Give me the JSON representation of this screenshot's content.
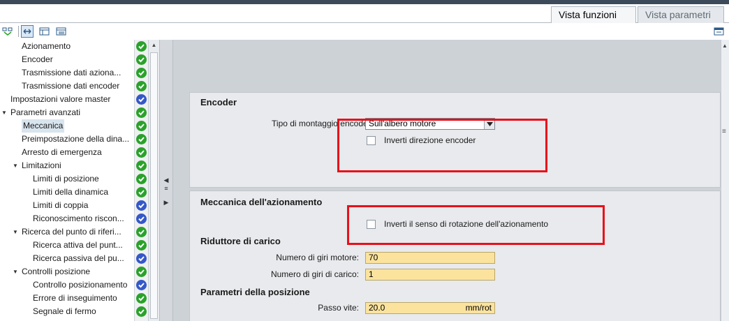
{
  "tabs": [
    {
      "label": "Vista funzioni",
      "active": true
    },
    {
      "label": "Vista parametri",
      "active": false
    }
  ],
  "toolbar": {
    "icons": [
      "network-view-icon",
      "expand-collapse-icon",
      "tree-view-icon",
      "list-view-icon",
      "settings-panel-icon"
    ]
  },
  "tree": {
    "items": [
      {
        "label": "Azionamento",
        "level": 2,
        "status": "green"
      },
      {
        "label": "Encoder",
        "level": 2,
        "status": "green"
      },
      {
        "label": "Trasmissione dati aziona...",
        "level": 2,
        "status": "green"
      },
      {
        "label": "Trasmissione dati encoder",
        "level": 2,
        "status": "green"
      },
      {
        "label": "Impostazioni valore master",
        "level": 1,
        "status": "blue"
      },
      {
        "label": "Parametri avanzati",
        "level": 1,
        "status": "green",
        "expander": "▼"
      },
      {
        "label": "Meccanica",
        "level": 2,
        "status": "green",
        "selected": true
      },
      {
        "label": "Preimpostazione della dina...",
        "level": 2,
        "status": "green"
      },
      {
        "label": "Arresto di emergenza",
        "level": 2,
        "status": "green"
      },
      {
        "label": "Limitazioni",
        "level": 2,
        "status": "green",
        "expander": "▼"
      },
      {
        "label": "Limiti di posizione",
        "level": 3,
        "status": "green"
      },
      {
        "label": "Limiti della dinamica",
        "level": 3,
        "status": "green"
      },
      {
        "label": "Limiti di coppia",
        "level": 3,
        "status": "blue"
      },
      {
        "label": "Riconoscimento riscon...",
        "level": 3,
        "status": "blue"
      },
      {
        "label": "Ricerca del punto di riferi...",
        "level": 2,
        "status": "green",
        "expander": "▼"
      },
      {
        "label": "Ricerca attiva del punt...",
        "level": 3,
        "status": "green"
      },
      {
        "label": "Ricerca passiva del pu...",
        "level": 3,
        "status": "blue"
      },
      {
        "label": "Controlli posizione",
        "level": 2,
        "status": "green",
        "expander": "▼"
      },
      {
        "label": "Controllo posizionamento",
        "level": 3,
        "status": "blue"
      },
      {
        "label": "Errore di inseguimento",
        "level": 3,
        "status": "green"
      },
      {
        "label": "Segnale di fermo",
        "level": 3,
        "status": "green"
      }
    ]
  },
  "encoder_section": {
    "title": "Encoder",
    "mount_type_label": "Tipo di montaggio encoder:",
    "mount_type_value": "Sull'albero motore",
    "invert_direction_label": "Inverti direzione encoder",
    "invert_direction_checked": false
  },
  "mechanics_section": {
    "title": "Meccanica dell'azionamento",
    "invert_rotation_label": "Inverti il senso di rotazione dell'azionamento",
    "invert_rotation_checked": false,
    "load_gear_title": "Riduttore di carico",
    "motor_revs_label": "Numero di giri motore:",
    "motor_revs_value": "70",
    "load_revs_label": "Numero di giri di carico:",
    "load_revs_value": "1",
    "position_params_title": "Parametri della posizione",
    "screw_pitch_label": "Passo vite:",
    "screw_pitch_value": "20.0",
    "screw_pitch_unit": "mm/rot"
  },
  "colors": {
    "highlight": "#e8101a",
    "status_ok": "#2aa22a",
    "status_info": "#3558c8",
    "input_bg": "#fbe39e"
  }
}
